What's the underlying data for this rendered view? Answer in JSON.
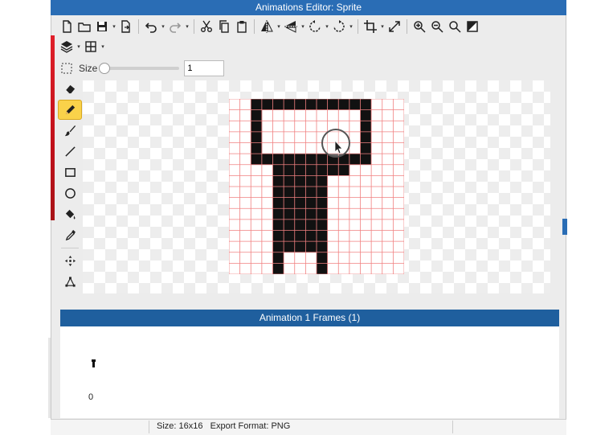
{
  "window": {
    "title": "Animations Editor: Sprite"
  },
  "toolbar": {
    "row1": [
      {
        "icon": "new-document-icon"
      },
      {
        "icon": "open-folder-icon"
      },
      {
        "icon": "save-icon",
        "dropdown": true
      },
      {
        "icon": "export-icon"
      },
      {
        "icon": "undo-icon",
        "dropdown": true
      },
      {
        "icon": "redo-icon",
        "dropdown": true
      },
      {
        "icon": "cut-icon"
      },
      {
        "icon": "copy-icon"
      },
      {
        "icon": "paste-icon"
      },
      {
        "icon": "flip-horizontal-icon",
        "dropdown": true
      },
      {
        "icon": "flip-vertical-icon",
        "dropdown": true
      },
      {
        "icon": "rotate-left-icon",
        "dropdown": true
      },
      {
        "icon": "rotate-right-icon",
        "dropdown": true
      },
      {
        "icon": "crop-icon",
        "dropdown": true
      },
      {
        "icon": "resize-icon"
      },
      {
        "icon": "zoom-in-icon"
      },
      {
        "icon": "zoom-out-icon"
      },
      {
        "icon": "zoom-fit-icon"
      },
      {
        "icon": "color-swap-icon"
      }
    ],
    "row2": [
      {
        "icon": "layers-icon",
        "dropdown": true
      },
      {
        "icon": "grid-icon",
        "dropdown": true
      }
    ]
  },
  "brush": {
    "size_label": "Size",
    "size_value": "1",
    "slider_fraction": 0.0
  },
  "tools": [
    "eraser-icon",
    "pencil-icon",
    "brush-icon",
    "line-icon",
    "rectangle-icon",
    "ellipse-icon",
    "fill-bucket-icon",
    "eyedropper-icon",
    "move-icon",
    "shape-nodes-icon"
  ],
  "active_tool": "pencil-icon",
  "sprite": {
    "width": 16,
    "height": 16,
    "pixels": [
      "..XXXXXXXXXXX...",
      "..X.........X...",
      "..X.........X...",
      "..X.........X...",
      "..X.........X...",
      "..XXXXXXXXXXX...",
      "....XXXXXXX.....",
      "....XXXXX.......",
      "....XXXXX.......",
      "....XXXXX.......",
      "....XXXXX.......",
      "....XXXXX.......",
      "....XXXXX.......",
      "....XXXXX.......",
      "....X...X.......",
      "....X...X......."
    ],
    "pixel_color": "#111111",
    "grid_color": "#f08080"
  },
  "frames": {
    "title": "Animation 1 Frames (1)",
    "items": [
      {
        "index": "0"
      }
    ]
  },
  "status": {
    "text": "Size: 16x16   Export Format: PNG"
  },
  "colors": {
    "title_bar": "#2a6db5",
    "frames_header": "#1f5f9e",
    "active_tool": "#fad24a"
  }
}
